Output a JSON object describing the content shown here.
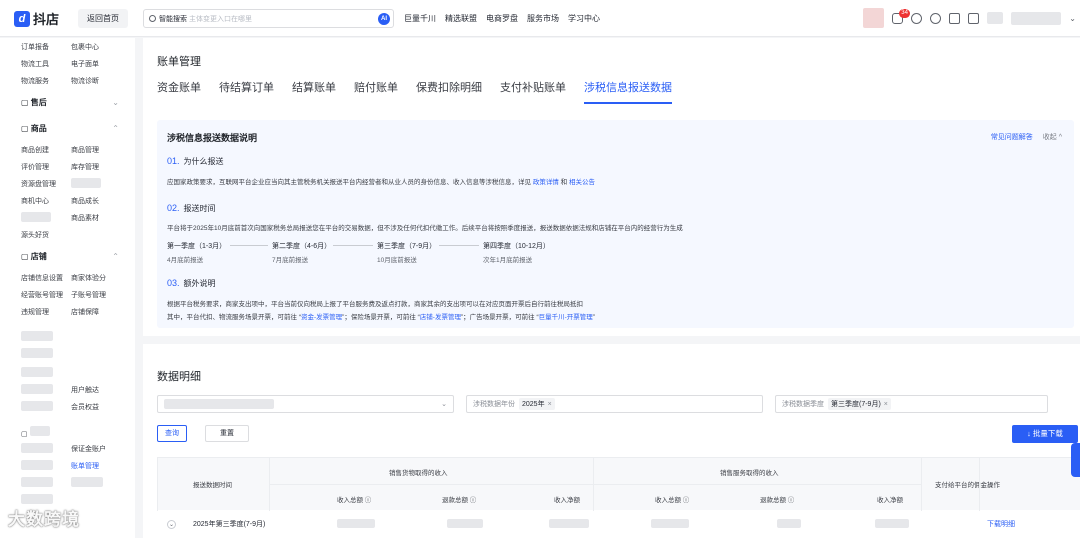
{
  "app": {
    "name": "抖店",
    "home_btn": "返回首页"
  },
  "search": {
    "label": "智能搜索",
    "placeholder": "主体变更入口在哪里",
    "ai": "AI"
  },
  "topnav": [
    "巨量千川",
    "精选联盟",
    "电商罗盘",
    "服务市场",
    "学习中心"
  ],
  "notif_count": "34",
  "sidebar": {
    "top_rows": [
      [
        "订单报备",
        "包裹中心"
      ],
      [
        "物流工具",
        "电子面单"
      ],
      [
        "物流服务",
        "物流诊断"
      ]
    ],
    "groups": {
      "after_sale": "售后",
      "goods": "商品",
      "goods_rows": [
        [
          "商品创建",
          "商品管理"
        ],
        [
          "评价管理",
          "库存管理"
        ],
        [
          "资源盘管理",
          ""
        ],
        [
          "商机中心",
          "商品成长"
        ],
        [
          "",
          "商品素材"
        ],
        [
          "源头好货",
          ""
        ]
      ],
      "shop": "店铺",
      "shop_rows": [
        [
          "店铺信息设置",
          "商家体验分"
        ],
        [
          "经营账号管理",
          "子账号管理"
        ],
        [
          "违规管理",
          "店铺保障"
        ]
      ],
      "other_rows": [
        [
          "",
          "用户触达"
        ],
        [
          "",
          "会员权益"
        ]
      ],
      "finance_rows": [
        [
          "",
          "保证金账户"
        ],
        [
          "",
          "账单管理"
        ]
      ]
    }
  },
  "page": {
    "title": "账单管理",
    "tabs": [
      "资金账单",
      "待结算订单",
      "结算账单",
      "赔付账单",
      "保费扣除明细",
      "支付补贴账单",
      "涉税信息报送数据"
    ],
    "active_tab": 6
  },
  "info": {
    "title": "涉税信息报送数据说明",
    "faq": "常见问题解答",
    "collapse": "收起 ^",
    "s1_num": "01.",
    "s1_title": "为什么报送",
    "s1_text": "应国家政策要求，互联网平台企业应当向其主管税务机关报送平台内经营者和从业人员的身份信息、收入信息等涉税信息，详见",
    "s1_link1": "政策详情",
    "s1_and": "和",
    "s1_link2": "相关公告",
    "s2_num": "02.",
    "s2_title": "报送时间",
    "s2_text": "平台将于2025年10月底前首次向国家税务总局报送您在平台的交易数据，但不涉及任何代扣代缴工作。后续平台将按照季度报送，报送数据依据法规和店铺在平台内的经营行为生成",
    "quarters": [
      {
        "name": "第一季度（1-3月）",
        "due": "4月底前报送"
      },
      {
        "name": "第二季度（4-6月）",
        "due": "7月底前报送"
      },
      {
        "name": "第三季度（7-9月）",
        "due": "10月底前报送"
      },
      {
        "name": "第四季度（10-12月）",
        "due": "次年1月底前报送"
      }
    ],
    "s3_num": "03.",
    "s3_title": "额外说明",
    "s3_text1": "根据平台税务要求，商家支出项中，平台当前仅向税局上报了平台服务费及返点打款，商家其余的支出项可以在对应页面开票后自行前往税局抵扣",
    "s3_text2a": "其中，平台代扣、物流服务场景开票，可前往 “",
    "s3_link1": "资金-发票管理",
    "s3_text2b": "”；保险场景开票，可前往 “",
    "s3_link2": "店铺-发票管理",
    "s3_text2c": "”；广告场景开票，可前往 “",
    "s3_link3": "巨量千川-开票管理",
    "s3_text2d": "”"
  },
  "detail": {
    "title": "数据明细",
    "filter_year_key": "涉税数据年份",
    "filter_year_val": "2025年",
    "filter_q_key": "涉税数据季度",
    "filter_q_val": "第三季度(7-9月)",
    "query_btn": "查询",
    "reset_btn": "重置",
    "download_btn": "↓ 批量下载",
    "headers": {
      "period": "报送数据时间",
      "goods_group": "销售货物取得的收入",
      "service_group": "销售服务取得的收入",
      "paid": "支付给平台的佣金...",
      "action": "操作",
      "total": "收入总额 ⓘ",
      "refund": "退款总额 ⓘ",
      "net": "收入净额"
    },
    "row": {
      "period": "2025年第三季度(7-9月)",
      "action": "下载明细"
    }
  },
  "watermark": "大数跨境"
}
